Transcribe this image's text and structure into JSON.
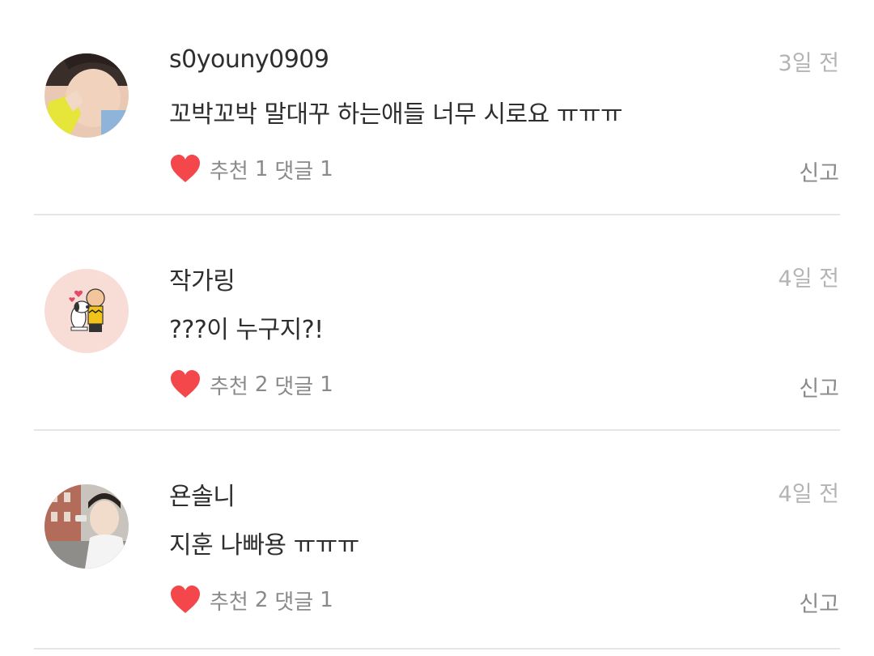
{
  "comments": [
    {
      "username": "s0youny0909",
      "time": "3일 전",
      "text": "꼬박꼬박 말대꾸 하는애들 너무 시로요 ㅠㅠㅠ",
      "like_label": "추천",
      "like_count": "1",
      "reply_label": "댓글",
      "reply_count": "1",
      "report_label": "신고",
      "avatar": "avatar-photo-yellow"
    },
    {
      "username": "작가링",
      "time": "4일 전",
      "text": "???이 누구지?!",
      "like_label": "추천",
      "like_count": "2",
      "reply_label": "댓글",
      "reply_count": "1",
      "report_label": "신고",
      "avatar": "avatar-snoopy-charlie"
    },
    {
      "username": "욘솔니",
      "time": "4일 전",
      "text": "지훈 나빠용 ㅠㅠㅠ",
      "like_label": "추천",
      "like_count": "2",
      "reply_label": "댓글",
      "reply_count": "1",
      "report_label": "신고",
      "avatar": "avatar-photo-street"
    }
  ],
  "colors": {
    "heart": "#f4474b",
    "username": "#2e2e2e",
    "muted": "#8a8a8a",
    "time": "#b4b4b4",
    "divider": "#e6e6e6"
  },
  "icons": {
    "like": "heart-icon"
  }
}
